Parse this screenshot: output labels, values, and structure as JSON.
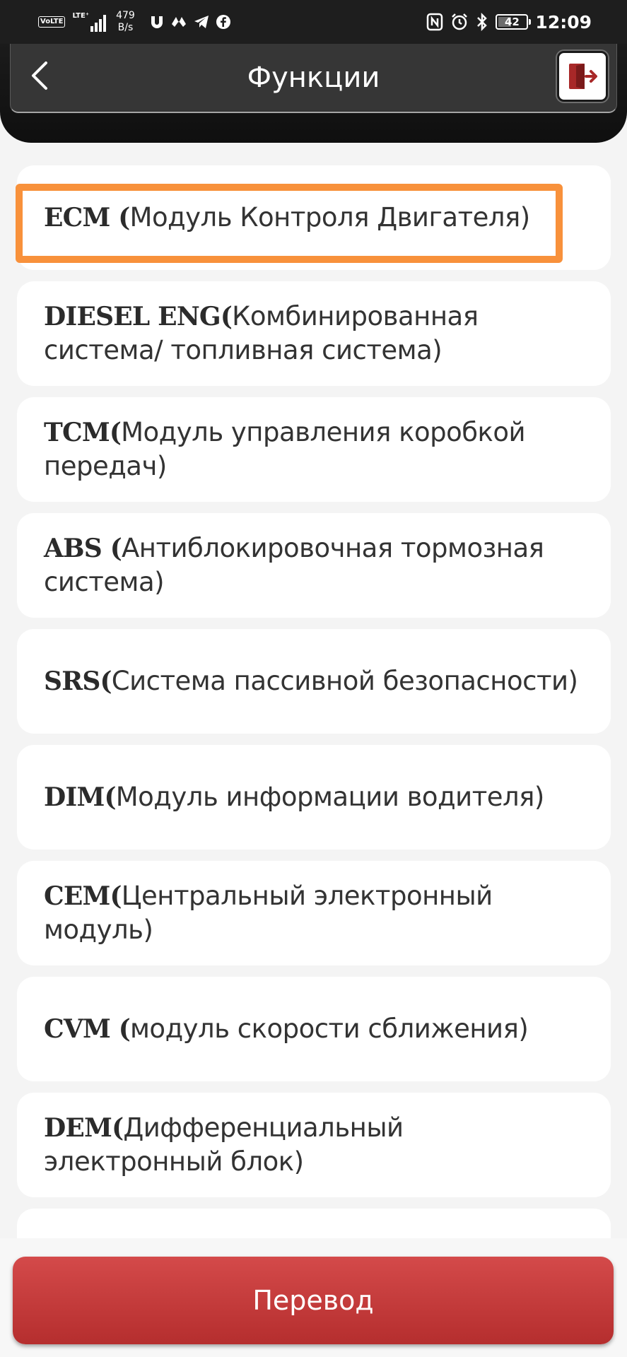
{
  "status_bar": {
    "volte": "VoLTE",
    "network": "LTE⁺",
    "speed_value": "479",
    "speed_unit": "B/s",
    "battery": "42",
    "time": "12:09"
  },
  "header": {
    "title": "Функции"
  },
  "list": {
    "items": [
      {
        "code": "ECM (",
        "desc": "Модуль Контроля Двигателя)"
      },
      {
        "code": "DIESEL ENG(",
        "desc": "Комбинированная система/ топливная система)"
      },
      {
        "code": "TCM(",
        "desc": "Модуль управления коробкой передач)"
      },
      {
        "code": "ABS (",
        "desc": "Антиблокировочная тормозная система)"
      },
      {
        "code": "SRS(",
        "desc": "Система пассивной безопасности)"
      },
      {
        "code": "DIM(",
        "desc": "Модуль информации водителя)"
      },
      {
        "code": "CEM(",
        "desc": "Центральный электронный модуль)"
      },
      {
        "code": "CVM (",
        "desc": "модуль скорости сближения)"
      },
      {
        "code": "DEM(",
        "desc": "Дифференциальный электронный блок)"
      }
    ]
  },
  "bottom": {
    "button_label": "Перевод"
  },
  "colors": {
    "accent": "#c23b3b",
    "highlight": "#f8913b",
    "header_bg": "#363636"
  }
}
